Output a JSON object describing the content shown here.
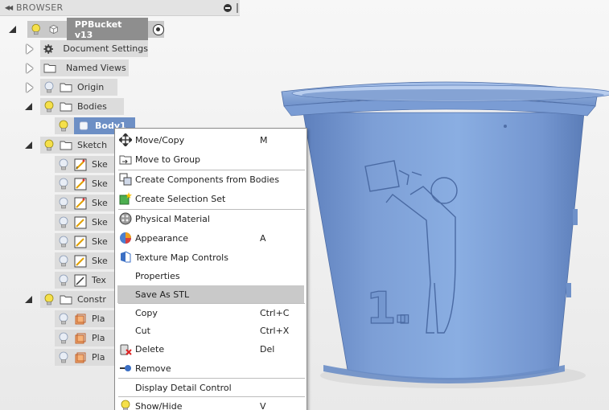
{
  "browser": {
    "title": "BROWSER",
    "root_label": "PPBucket v13",
    "items": {
      "document_settings": "Document Settings",
      "named_views": "Named Views",
      "origin": "Origin",
      "bodies": "Bodies",
      "body1": "Body1",
      "sketches": "Sketch",
      "sketch_rows": [
        "Ske",
        "Ske",
        "Ske",
        "Ske",
        "Ske",
        "Ske",
        "Tex"
      ],
      "construction": "Constr",
      "plane_rows": [
        "Pla",
        "Pla",
        "Pla"
      ]
    }
  },
  "context_menu": {
    "items": [
      {
        "label": "Move/Copy",
        "shortcut": "M"
      },
      {
        "label": "Move to Group",
        "shortcut": ""
      },
      {
        "label": "Create Components from Bodies",
        "shortcut": ""
      },
      {
        "label": "Create Selection Set",
        "shortcut": ""
      },
      {
        "label": "Physical Material",
        "shortcut": ""
      },
      {
        "label": "Appearance",
        "shortcut": "A"
      },
      {
        "label": "Texture Map Controls",
        "shortcut": ""
      },
      {
        "label": "Properties",
        "shortcut": ""
      },
      {
        "label": "Save As STL",
        "shortcut": ""
      },
      {
        "label": "Copy",
        "shortcut": "Ctrl+C"
      },
      {
        "label": "Cut",
        "shortcut": "Ctrl+X"
      },
      {
        "label": "Delete",
        "shortcut": "Del"
      },
      {
        "label": "Remove",
        "shortcut": ""
      },
      {
        "label": "Display Detail Control",
        "shortcut": ""
      },
      {
        "label": "Show/Hide",
        "shortcut": "V"
      }
    ]
  },
  "viewport": {
    "cup_color": "#7d9fd6",
    "cup_text": "1."
  }
}
